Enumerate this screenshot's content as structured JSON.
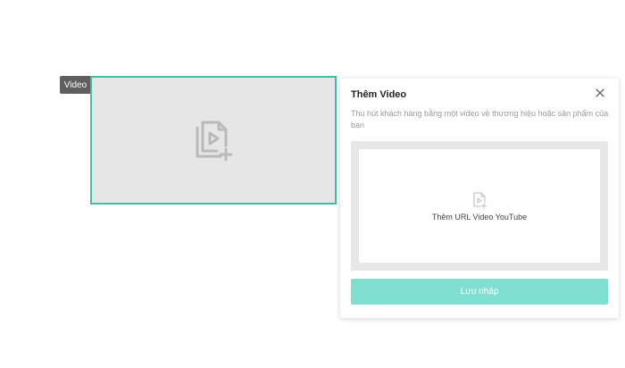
{
  "video_block": {
    "tag_label": "Video",
    "icon": "video-files-add-icon",
    "border_color": "#3cc0a5"
  },
  "panel": {
    "title": "Thêm Video",
    "close_icon": "close-icon",
    "description": "Thu hút khách hàng bằng một video về thương hiệu hoặc sản phẩm của bạn",
    "drop_area": {
      "icon": "video-file-add-icon",
      "label": "Thêm URL Video YouTube"
    },
    "save_button": {
      "label": "Lưu nháp",
      "color": "#7fdfd0"
    }
  }
}
